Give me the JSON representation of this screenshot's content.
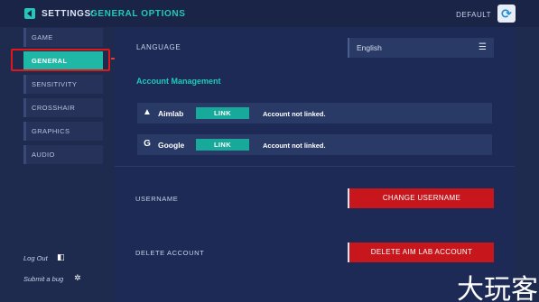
{
  "header": {
    "title_prefix": "SETTINGS:",
    "title_section": "GENERAL OPTIONS",
    "default_label": "DEFAULT",
    "reset_glyph": "⟳"
  },
  "sidebar": {
    "items": [
      {
        "label": "GAME",
        "active": false
      },
      {
        "label": "GENERAL",
        "active": true
      },
      {
        "label": "SENSITIVITY",
        "active": false
      },
      {
        "label": "CROSSHAIR",
        "active": false
      },
      {
        "label": "GRAPHICS",
        "active": false
      },
      {
        "label": "AUDIO",
        "active": false
      }
    ],
    "log_out": "Log Out",
    "submit_bug": "Submit a bug"
  },
  "language": {
    "label": "LANGUAGE",
    "value": "English"
  },
  "account_management": {
    "heading": "Account Management",
    "accounts": [
      {
        "provider": "Aimlab",
        "icon": "aimlab-logo-icon",
        "button": "LINK",
        "status": "Account not linked."
      },
      {
        "provider": "Google",
        "icon": "google-logo-icon",
        "button": "LINK",
        "status": "Account not linked."
      }
    ]
  },
  "username": {
    "label": "USERNAME",
    "button": "CHANGE USERNAME"
  },
  "delete_account": {
    "label": "DELETE ACCOUNT",
    "button": "DELETE AIM LAB ACCOUNT"
  },
  "watermark": "大玩客",
  "colors": {
    "accent": "#20c9b9",
    "danger": "#c7161c",
    "annotation": "#e01818"
  }
}
